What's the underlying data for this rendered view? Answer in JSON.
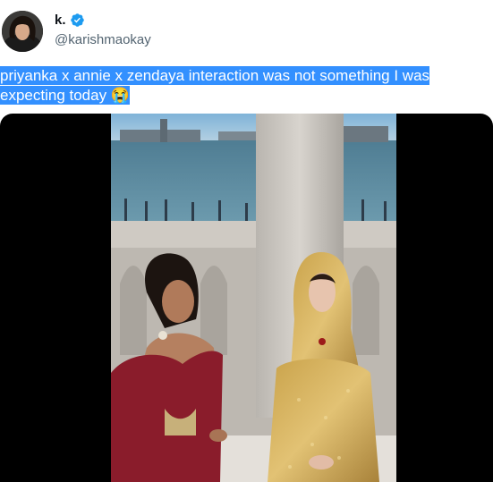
{
  "tweet": {
    "display_name": "k.",
    "handle": "@karishmaokay",
    "text_line1": "priyanka x annie x zendaya interaction was not something I was",
    "text_line2": "expecting today",
    "emoji": "😭",
    "verified_icon": "verified-badge-icon"
  },
  "media": {
    "type": "video-frame"
  },
  "colors": {
    "selection": "#3390ff",
    "verified": "#1d9bf0",
    "handle": "#536471"
  }
}
